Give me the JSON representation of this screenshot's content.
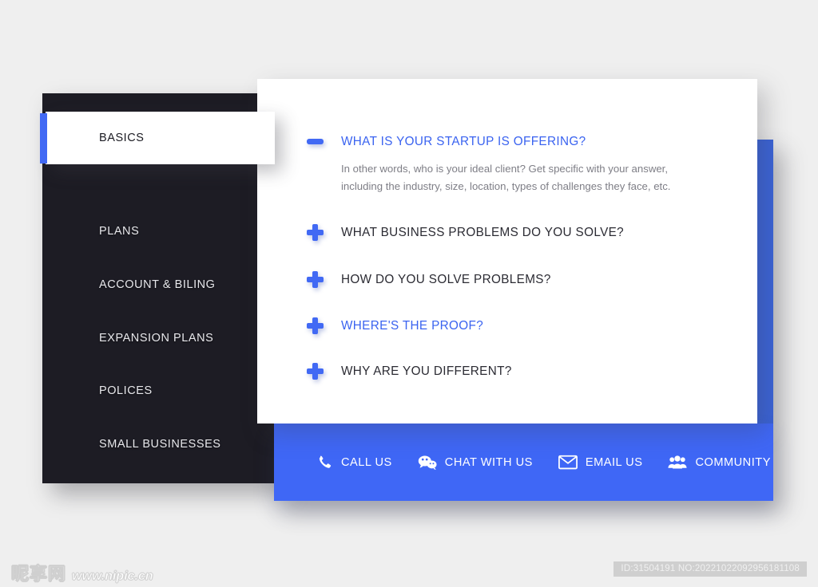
{
  "page": {
    "background_color": "#efefef",
    "accent_blue": "#4169f4",
    "footer_blue": "#3f67f6",
    "backplate_blue": "#3a63d8",
    "sidebar_dark": "#1d1c24"
  },
  "sidebar": {
    "items": [
      {
        "label": "BASICS",
        "active": true
      },
      {
        "label": "PLANS",
        "active": false
      },
      {
        "label": "ACCOUNT & BILING",
        "active": false
      },
      {
        "label": "EXPANSION PLANS",
        "active": false
      },
      {
        "label": "POLICES",
        "active": false
      },
      {
        "label": "SMALL BUSINESSES",
        "active": false
      }
    ]
  },
  "faq": {
    "items": [
      {
        "title": "WHAT IS YOUR STARTUP IS OFFERING?",
        "state": "expanded",
        "icon": "minus-icon",
        "highlighted": true,
        "answer_line_1": "In other words, who is your ideal client? Get specific with your answer,",
        "answer_line_2": "including the industry, size, location, types of challenges they face, etc."
      },
      {
        "title": "WHAT BUSINESS PROBLEMS DO YOU SOLVE?",
        "state": "collapsed",
        "icon": "plus-icon",
        "highlighted": false
      },
      {
        "title": "HOW DO YOU SOLVE PROBLEMS?",
        "state": "collapsed",
        "icon": "plus-icon",
        "highlighted": false
      },
      {
        "title": "WHERE'S THE PROOF?",
        "state": "collapsed",
        "icon": "plus-icon",
        "highlighted": true
      },
      {
        "title": "WHY ARE YOU DIFFERENT?",
        "state": "collapsed",
        "icon": "plus-icon",
        "highlighted": false
      }
    ]
  },
  "contact_bar": {
    "items": [
      {
        "label": "CALL US",
        "icon": "phone-icon"
      },
      {
        "label": "CHAT WITH US",
        "icon": "chat-bubbles-icon"
      },
      {
        "label": "EMAIL US",
        "icon": "envelope-icon"
      },
      {
        "label": "COMMUNITY",
        "icon": "people-group-icon"
      }
    ]
  },
  "watermark": {
    "site_name_cn": "昵享网",
    "site_url": "www.nipic.cn",
    "id_text": "ID:31504191 NO:20221022092956181108"
  }
}
